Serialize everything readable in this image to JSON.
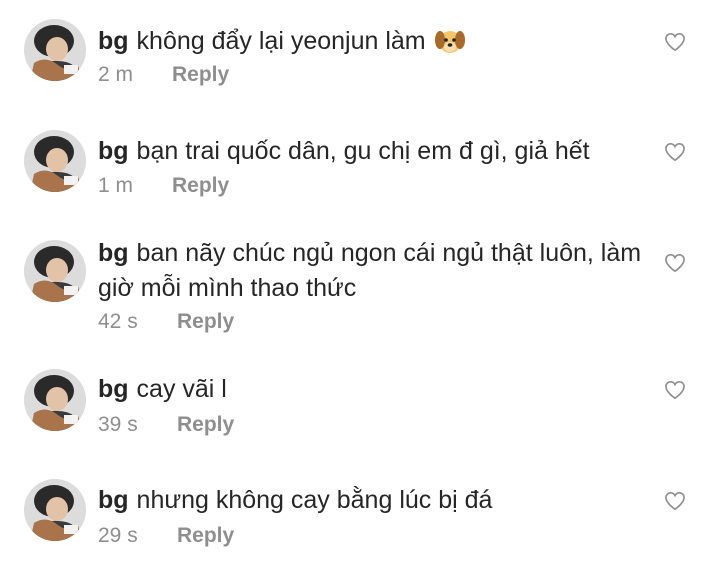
{
  "comments": [
    {
      "username": "bg",
      "text": "không đẩy lại yeonjun làm",
      "emoji": "dog-face-emoji",
      "time": "2 m",
      "reply": "Reply"
    },
    {
      "username": "bg",
      "text": "bạn trai quốc dân, gu chị em đ gì, giả hết",
      "time": "1 m",
      "reply": "Reply"
    },
    {
      "username": "bg",
      "text": "ban nãy chúc ngủ ngon cái ngủ thật luôn, làm giờ mỗi mình thao thức",
      "time": "42 s",
      "reply": "Reply"
    },
    {
      "username": "bg",
      "text": "cay vãi l",
      "time": "39 s",
      "reply": "Reply"
    },
    {
      "username": "bg",
      "text": "nhưng không cay bằng lúc bị đá",
      "time": "29 s",
      "reply": "Reply"
    }
  ],
  "icons": {
    "like": "heart-outline-icon",
    "avatar": "user-avatar"
  },
  "colors": {
    "text": "#262626",
    "secondary": "#8e8e8e",
    "icon": "#8e8e8e",
    "background": "#ffffff"
  }
}
